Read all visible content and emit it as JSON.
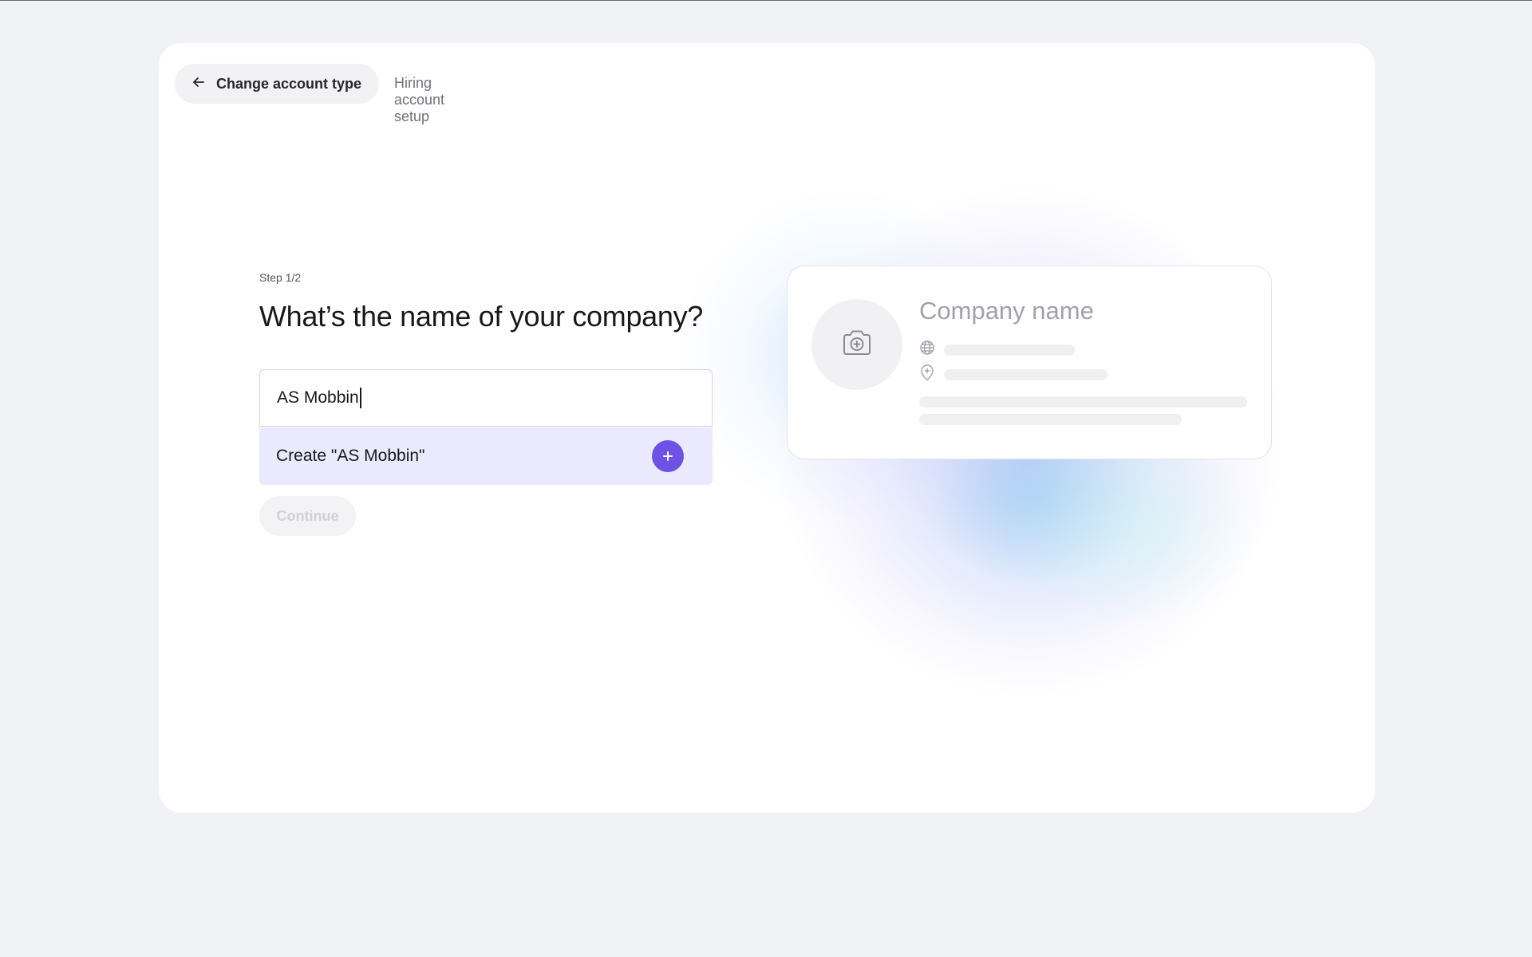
{
  "header": {
    "back_label": "Change account type",
    "breadcrumb": "Hiring account setup"
  },
  "form": {
    "step": "Step 1/2",
    "title": "What’s the name of your company?",
    "input_value": "AS Mobbin",
    "suggestion_label": "Create \"AS Mobbin\"",
    "continue_label": "Continue"
  },
  "preview": {
    "company_placeholder": "Company name"
  },
  "icons": {
    "back": "arrow-left-icon",
    "add": "plus-icon",
    "logo_upload": "camera-plus-icon",
    "website": "globe-icon",
    "location": "map-pin-icon"
  },
  "colors": {
    "accent": "#6d52e4",
    "suggestion_bg": "#ebe9fd"
  }
}
